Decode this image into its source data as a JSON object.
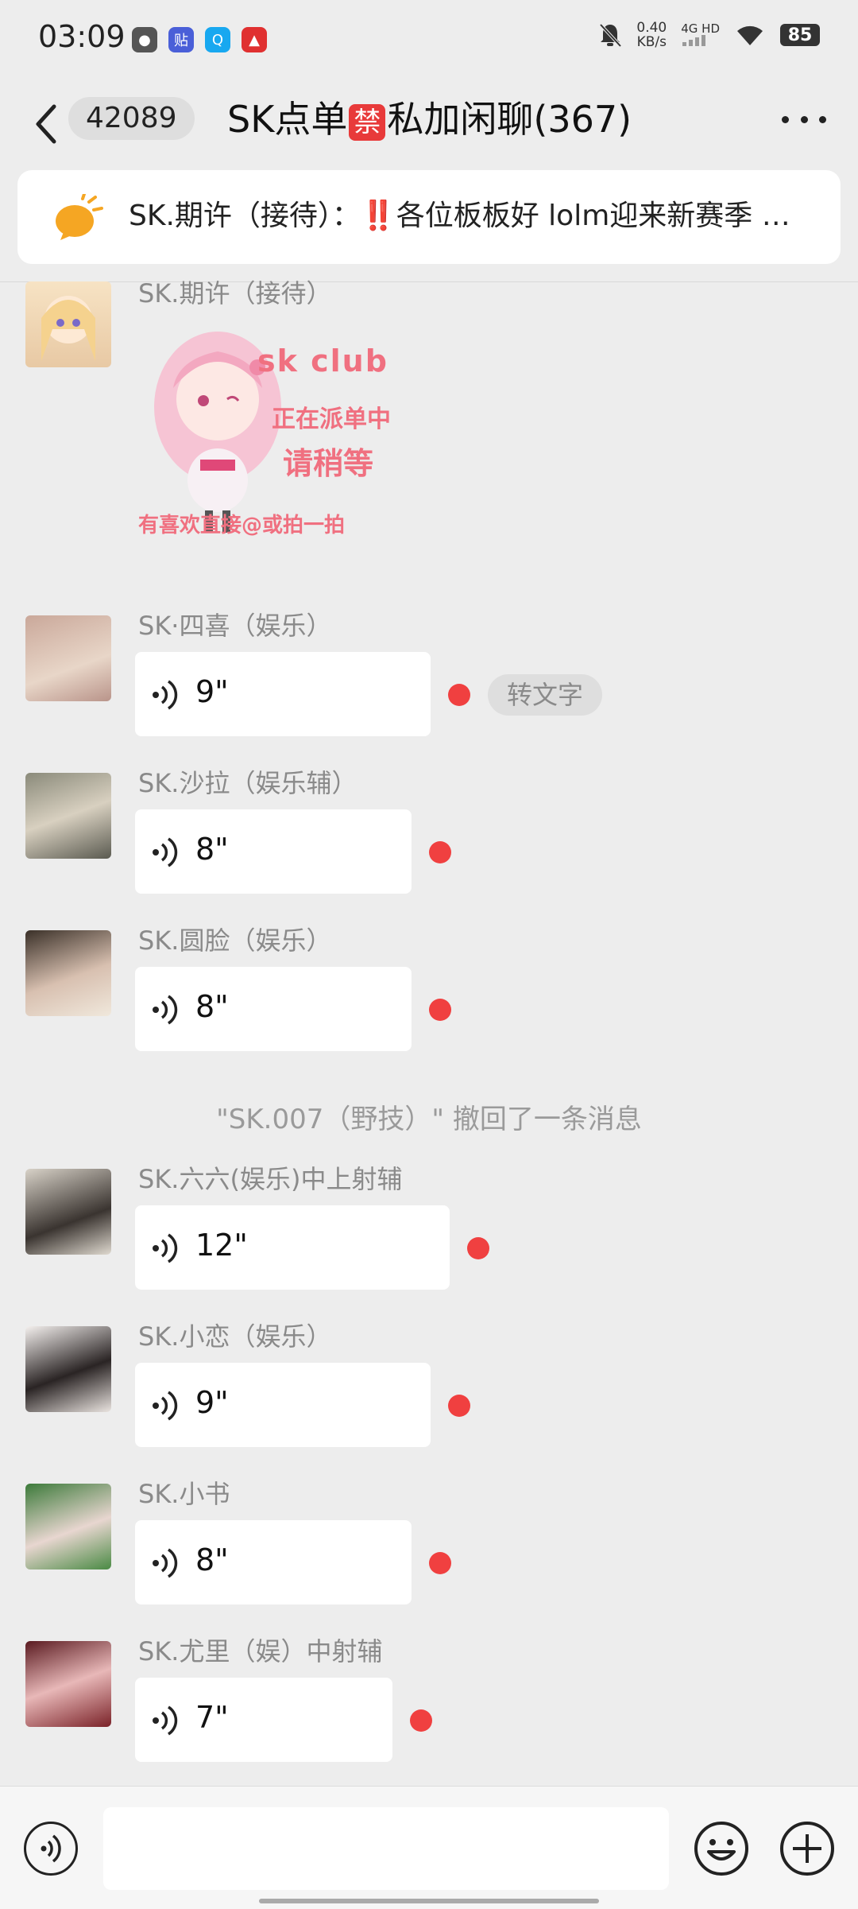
{
  "status_bar": {
    "time": "03:09",
    "net_speed_value": "0.40",
    "net_speed_unit": "KB/s",
    "network_type": "4G HD",
    "battery": "85",
    "app_icons": [
      "wechat-icon",
      "tieba-icon",
      "qq-icon",
      "pinduoduo-icon"
    ]
  },
  "header": {
    "unread_count": "42089",
    "title_prefix": "SK点单",
    "title_forbidden": "禁",
    "title_suffix": "私加闲聊(367)"
  },
  "announcement": {
    "text": "SK.期许（接待）：‼️各位板板好 lolm迎来新赛季 …"
  },
  "messages": [
    {
      "sender": "SK.期许（接待）",
      "type": "sticker"
    },
    {
      "sender": "SK·四喜（娱乐）",
      "duration": "9\"",
      "to_text": "转文字"
    },
    {
      "sender": "SK.沙拉（娱乐辅）",
      "duration": "8\""
    },
    {
      "sender": "SK.圆脸（娱乐）",
      "duration": "8\""
    },
    {
      "sender": "SK.六六(娱乐)中上射辅",
      "duration": "12\""
    },
    {
      "sender": "SK.小恋（娱乐）",
      "duration": "9\""
    },
    {
      "sender": "SK.小书",
      "duration": "8\""
    },
    {
      "sender": "SK.尤里（娱）中射辅",
      "duration": "7\""
    }
  ],
  "sticker": {
    "line1": "sk club",
    "line2": "正在派单中",
    "line3": "请稍等",
    "line4": "有喜欢直接@或拍一拍"
  },
  "recall_notice": "\"SK.007（野技）\" 撤回了一条消息",
  "colors": {
    "background": "#ededed",
    "bubble": "#ffffff",
    "unread_dot": "#f04040",
    "forbidden_badge": "#e83a3a",
    "sender_text": "#8a8a8a"
  }
}
